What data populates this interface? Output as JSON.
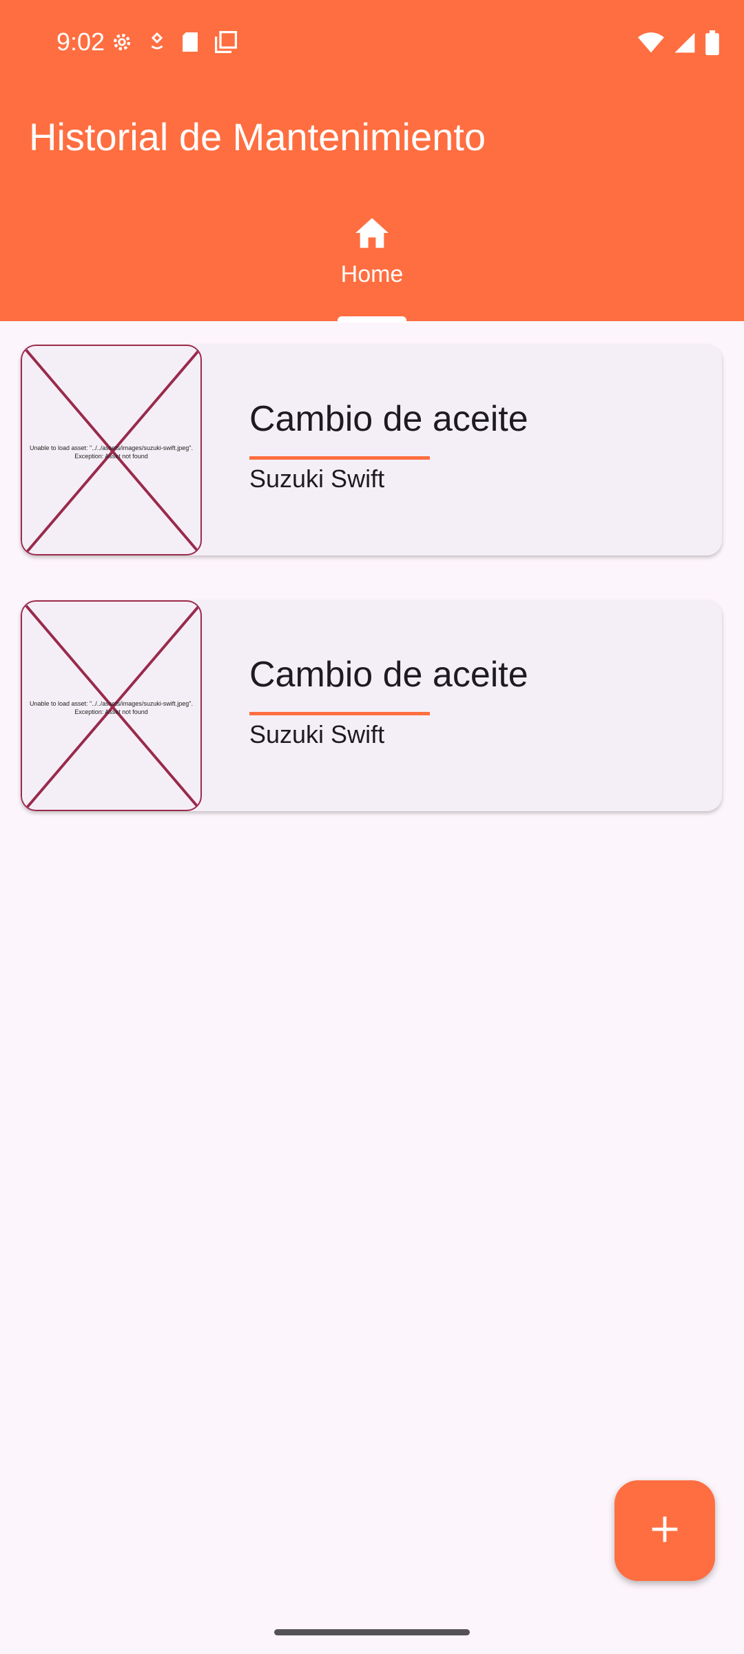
{
  "status_bar": {
    "time": "9:02",
    "left_icons": [
      "settings-icon",
      "medical-icon",
      "sd-card-icon",
      "copy-icon"
    ],
    "right_icons": [
      "wifi-icon",
      "signal-icon",
      "battery-icon"
    ]
  },
  "app_bar": {
    "title": "Historial de Mantenimiento",
    "background": "#ff6e40"
  },
  "tabs": [
    {
      "label": "Home",
      "icon": "home-icon",
      "selected": true
    }
  ],
  "records": [
    {
      "title": "Cambio de aceite",
      "subtitle": "Suzuki Swift",
      "image_error": "Unable to load asset: \"../../assets/images/suzuki-swift.jpeg\". Exception: Asset not found"
    },
    {
      "title": "Cambio de aceite",
      "subtitle": "Suzuki Swift",
      "image_error": "Unable to load asset: \"../../assets/images/suzuki-swift.jpeg\". Exception: Asset not found"
    }
  ],
  "fab": {
    "icon": "plus-icon"
  },
  "colors": {
    "accent": "#ff6e40",
    "background": "#fcf5fb",
    "card": "#f4eff6",
    "error_border": "#9a2a4b"
  }
}
